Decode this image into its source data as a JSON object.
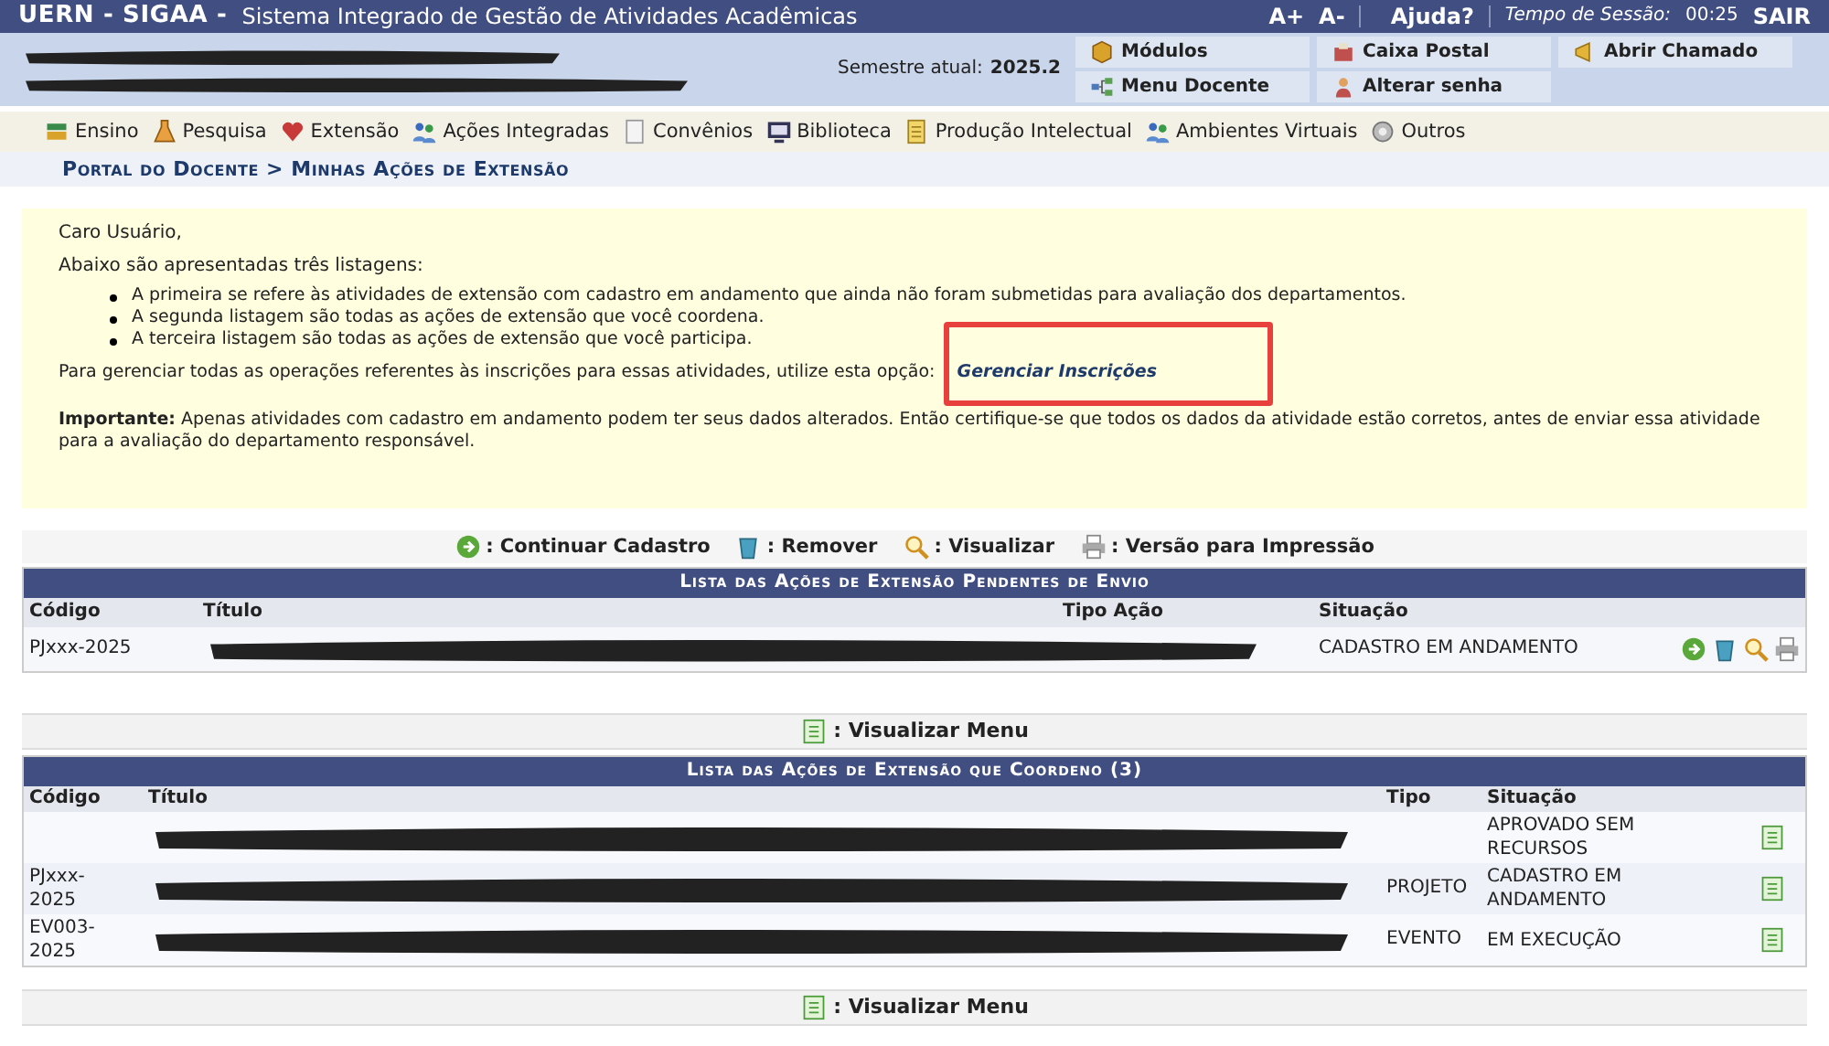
{
  "header": {
    "brand": "UERN - SIGAA -",
    "system": "Sistema Integrado de Gestão de Atividades Acadêmicas",
    "font_up": "A+",
    "font_down": "A-",
    "help": "Ajuda?",
    "session_label": "Tempo de Sessão:",
    "session_time": "00:25",
    "logout": "SAIR"
  },
  "info": {
    "semester_label": "Semestre atual:",
    "semester": "2025.2",
    "shortcuts": [
      "Módulos",
      "Caixa Postal",
      "Abrir Chamado",
      "Menu Docente",
      "Alterar senha"
    ]
  },
  "menu": [
    "Ensino",
    "Pesquisa",
    "Extensão",
    "Ações Integradas",
    "Convênios",
    "Biblioteca",
    "Produção Intelectual",
    "Ambientes Virtuais",
    "Outros"
  ],
  "breadcrumb": "Portal do Docente > Minhas Ações de Extensão",
  "notice": {
    "greeting": "Caro Usuário,",
    "intro": "Abaixo são apresentadas três listagens:",
    "bullets": [
      "A primeira se refere às atividades de extensão com cadastro em andamento que ainda não foram submetidas para avaliação dos departamentos.",
      "A segunda listagem são todas as ações de extensão que você coordena.",
      "A terceira listagem são todas as ações de extensão que você participa."
    ],
    "manage_text": "Para gerenciar todas as operações referentes às inscrições para essas atividades, utilize esta opção:",
    "manage_link": "Gerenciar Inscrições",
    "important": "**Importante:** Apenas atividades com cadastro em andamento podem ter seus dados alterados. Então certifique-se que todos os dados da atividade estão corretos, antes de enviar essa atividade para a avaliação do departamento responsável."
  },
  "legend": [
    ": Continuar Cadastro",
    ": Remover",
    ": Visualizar",
    ": Versão para Impressão"
  ],
  "pending_table": {
    "title": "Lista das Ações de Extensão Pendentes de Envio",
    "columns": [
      "Código",
      "Título",
      "Tipo Ação",
      "Situação"
    ],
    "rows": [
      {
        "code": "PJxxx-2025",
        "status": "CADASTRO EM ANDAMENTO"
      }
    ]
  },
  "menu_link_1": ": Visualizar Menu",
  "coord_table": {
    "title": "Lista das Ações de Extensão que Coordeno (3)",
    "columns": [
      "Código",
      "Título",
      "Tipo",
      "Situação"
    ],
    "rows": [
      {
        "status": "APROVADO SEM RECURSOS"
      },
      {
        "code": "PJxxx-2025",
        "type": "PROJETO",
        "status": "CADASTRO EM ANDAMENTO"
      },
      {
        "code": "EV003-2025",
        "type": "EVENTO",
        "status": "EM EXECUÇÃO"
      }
    ]
  },
  "menu_link_2": ": Visualizar Menu"
}
